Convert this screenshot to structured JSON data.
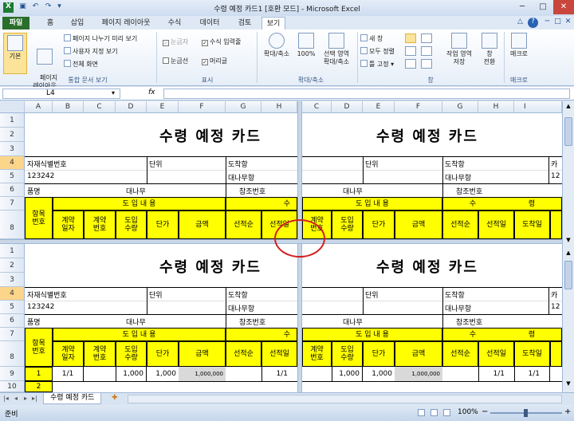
{
  "window": {
    "title": "수령 예정 카드1  [호환 모드] - Microsoft Excel",
    "minimize": "─",
    "maximize": "□",
    "close": "✕"
  },
  "tabs": [
    "파일",
    "홈",
    "삽입",
    "페이지 레이아웃",
    "수식",
    "데이터",
    "검토",
    "보기"
  ],
  "ribbon": {
    "workbook_views": {
      "normal": "기본",
      "page_layout": "페이지\n레이아웃",
      "page_break": "페이지 나누기 미리 보기",
      "custom_views": "사용자 지정 보기",
      "full_screen": "전체 화면",
      "label": "통합 문서 보기"
    },
    "show": {
      "ruler": "눈금자",
      "formula_bar": "수식 입력줄",
      "gridlines": "눈금선",
      "headings": "머리글",
      "label": "표시"
    },
    "zoom": {
      "zoom": "확대/축소",
      "zoom100": "100%",
      "zoom_selection": "선택 영역\n확대/축소",
      "label": "확대/축소"
    },
    "window": {
      "new_window": "새 창",
      "arrange_all": "모두 정렬",
      "freeze_panes": "틀 고정",
      "save_workspace": "작업 영역\n저장",
      "switch_windows": "창\n전환",
      "label": "창"
    },
    "macros": {
      "macros": "매크로",
      "label": "매크로"
    }
  },
  "formula_bar": {
    "name_box": "L4",
    "fx": "fx",
    "value": ""
  },
  "columns_left": [
    "A",
    "B",
    "C",
    "D",
    "E",
    "F",
    "G",
    "H"
  ],
  "columns_right": [
    "C",
    "D",
    "E",
    "F",
    "G",
    "H",
    "I"
  ],
  "rows_top": [
    "1",
    "2",
    "3",
    "4",
    "5",
    "6",
    "7",
    "8"
  ],
  "rows_bottom": [
    "1",
    "2",
    "3",
    "4",
    "5",
    "6",
    "7",
    "8",
    "9",
    "10"
  ],
  "card": {
    "title": "수령 예정 카드",
    "item_id_label": "자재식별번호",
    "item_id": "123242",
    "unit_label": "단위",
    "dest_label": "도착항",
    "dest": "대나무항",
    "dest_short": "카",
    "dest_num": "12",
    "item_name_label": "품명",
    "item_name": "대나무",
    "ref_label": "참조번호",
    "seq_label": "항목\n번호",
    "import_header": "도 입 내 용",
    "su": "수",
    "ryeong": "령",
    "contract_date": "계약\n일자",
    "contract_no": "계약\n번호",
    "import_qty": "도입\n수량",
    "unit_price": "단가",
    "amount": "금액",
    "ship_order": "선적순",
    "ship_date": "선적일",
    "arrival_date": "도착일"
  },
  "row9": {
    "seq": "1",
    "contract_date": "1/1",
    "import_qty": "1,000",
    "unit_price": "1,000",
    "amount": "1,000,000",
    "ship_date": "1/1",
    "arrival_date": "1/1"
  },
  "row10": {
    "seq": "2"
  },
  "sheet_tab": "수령 예정 카드",
  "status": {
    "ready": "준비",
    "zoom": "100%",
    "zoom_minus": "−",
    "zoom_plus": "+"
  }
}
